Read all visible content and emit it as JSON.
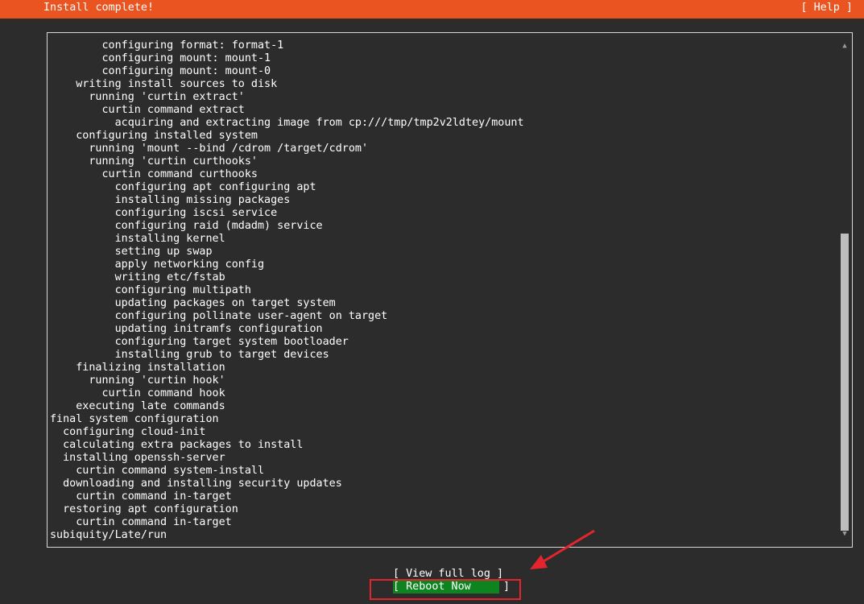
{
  "header": {
    "title": "Install complete!",
    "help_label": "[ Help ]"
  },
  "log": {
    "lines": [
      "        configuring format: format-1",
      "        configuring mount: mount-1",
      "        configuring mount: mount-0",
      "    writing install sources to disk",
      "      running 'curtin extract'",
      "        curtin command extract",
      "          acquiring and extracting image from cp:///tmp/tmp2v2ldtey/mount",
      "    configuring installed system",
      "      running 'mount --bind /cdrom /target/cdrom'",
      "      running 'curtin curthooks'",
      "        curtin command curthooks",
      "          configuring apt configuring apt",
      "          installing missing packages",
      "          configuring iscsi service",
      "          configuring raid (mdadm) service",
      "          installing kernel",
      "          setting up swap",
      "          apply networking config",
      "          writing etc/fstab",
      "          configuring multipath",
      "          updating packages on target system",
      "          configuring pollinate user-agent on target",
      "          updating initramfs configuration",
      "          configuring target system bootloader",
      "          installing grub to target devices",
      "    finalizing installation",
      "      running 'curtin hook'",
      "        curtin command hook",
      "    executing late commands",
      "final system configuration",
      "  configuring cloud-init",
      "  calculating extra packages to install",
      "  installing openssh-server",
      "    curtin command system-install",
      "  downloading and installing security updates",
      "    curtin command in-target",
      "  restoring apt configuration",
      "    curtin command in-target",
      "subiquity/Late/run"
    ]
  },
  "scrollbar": {
    "up_icon": "▲",
    "down_icon": "▼"
  },
  "buttons": {
    "view_log_label": "[ View full log ]",
    "reboot_label": "[ Reboot Now     ]"
  },
  "colors": {
    "header_bg": "#e95420",
    "background": "#2c2c2c",
    "selected_button_bg": "#0e8420",
    "annotation_red": "#e3262d"
  }
}
